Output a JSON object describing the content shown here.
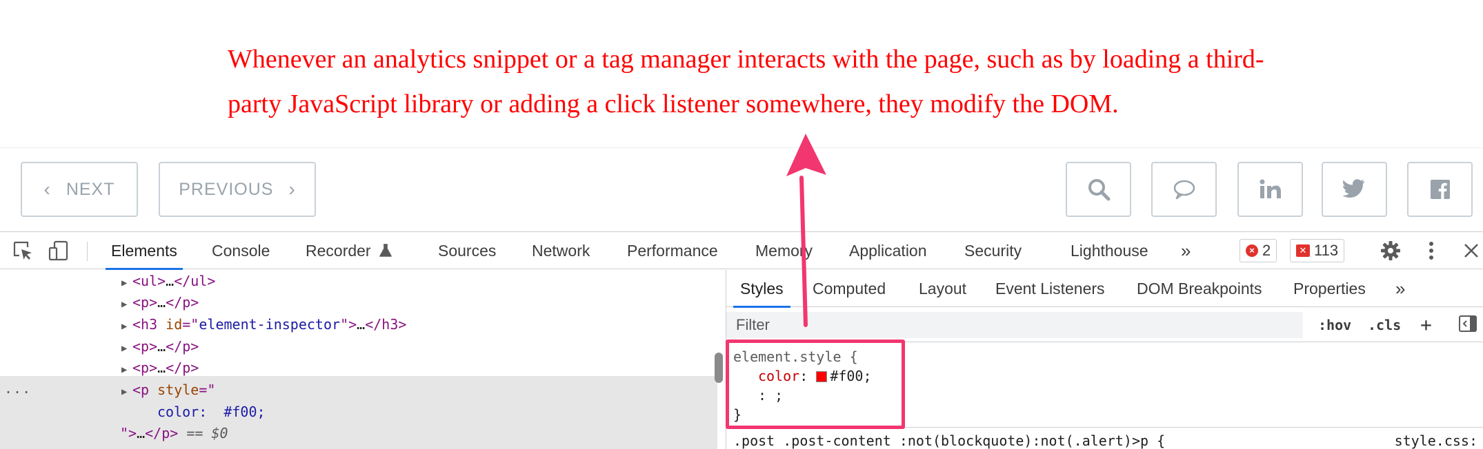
{
  "article": {
    "text": "Whenever an analytics snippet or a tag manager interacts with the page, such as by loading a third-party JavaScript library or adding a click listener somewhere, they modify the DOM."
  },
  "post_nav": {
    "next_label": "NEXT",
    "previous_label": "PREVIOUS",
    "share_icons": [
      "search-icon",
      "comment-icon",
      "linkedin-icon",
      "twitter-icon",
      "facebook-icon"
    ]
  },
  "devtools": {
    "tabs": [
      "Elements",
      "Console",
      "Recorder",
      "Sources",
      "Network",
      "Performance",
      "Memory",
      "Application",
      "Security",
      "Lighthouse"
    ],
    "more_tabs": "»",
    "errors_count": "2",
    "issues_count": "113",
    "elements": {
      "lines": {
        "ul": {
          "open": "<ul>",
          "ellipsis": "…",
          "close": "</ul>"
        },
        "p1": {
          "open": "<p>",
          "ellipsis": "…",
          "close": "</p>"
        },
        "h3": {
          "tag": "<h3",
          "attr_name": "id",
          "attr_value": "element-inspector",
          "end": ">",
          "ellipsis": "…",
          "close": "</h3>"
        },
        "p2": {
          "open": "<p>",
          "ellipsis": "…",
          "close": "</p>"
        },
        "p3": {
          "open": "<p>",
          "ellipsis": "…",
          "close": "</p>"
        },
        "p_style": {
          "tag": "<p",
          "attr_name": "style",
          "open_quote": "=\""
        },
        "style_value": "color:  #f00;",
        "closing": {
          "quote": "\">",
          "ellipsis": "…",
          "close": "</p>",
          "eq": " == ",
          "ref": "$0"
        }
      },
      "row_dots": "..."
    },
    "styles_panel": {
      "tabs": [
        "Styles",
        "Computed",
        "Layout",
        "Event Listeners",
        "DOM Breakpoints",
        "Properties"
      ],
      "more_tabs": "»",
      "filter_placeholder": "Filter",
      "hov_label": ":hov",
      "cls_label": ".cls",
      "add_label": "+",
      "element_style": {
        "selector": "element.style {",
        "prop_name": "color",
        "prop_sep": ": ",
        "prop_value": "#f00;",
        "empty_line": ": ;",
        "close": "}"
      },
      "next_rule_selector": ".post .post-content :not(blockquote):not(.alert)>p {",
      "next_rule_source": "style.css:"
    }
  },
  "colors": {
    "article_text": "#ff0000",
    "annotation": "#f2366f",
    "active_tab_underline": "#1a73e8"
  }
}
